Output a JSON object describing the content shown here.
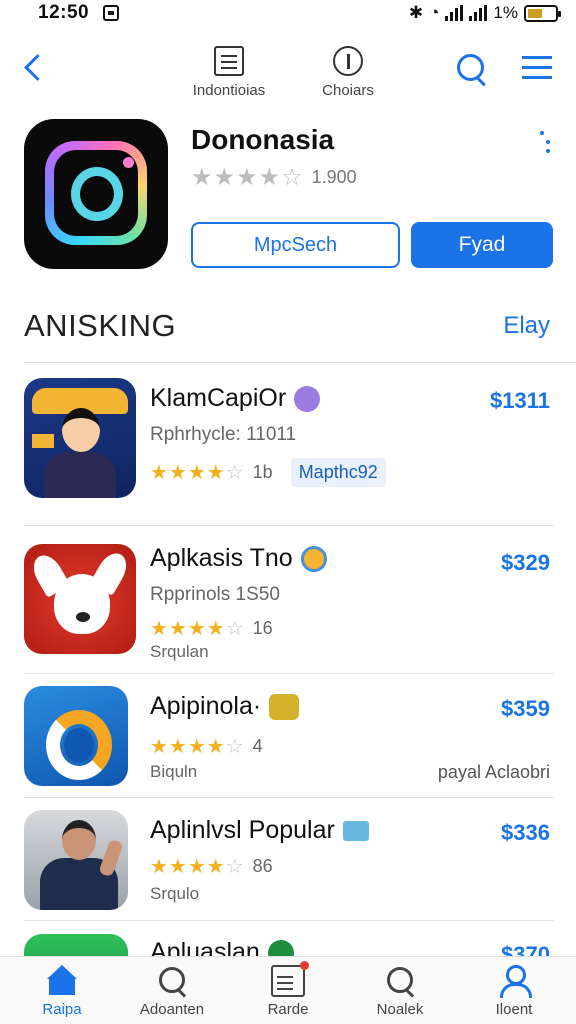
{
  "status_bar": {
    "time": "12:50",
    "battery": "1%"
  },
  "nav": {
    "tab1_label": "Indontioias",
    "tab2_label": "Choiars"
  },
  "app": {
    "title": "Dononasia",
    "rating_count": "1.900",
    "button_secondary": "MpcSech",
    "button_primary": "Fyad"
  },
  "section": {
    "title": "ANISKING",
    "link": "Elay"
  },
  "list": [
    {
      "name": "KlamCapiOr",
      "sub": "Rphrhycle: 11011",
      "rating": "1b",
      "tag": "Mapthc92",
      "price": "$1311"
    },
    {
      "name": "Aplkasis Tno",
      "sub": "Rpprinols 1S50",
      "rating": "16",
      "extra_left": "Srqulan",
      "price": "$329"
    },
    {
      "name": "Apipinola·",
      "rating": "4",
      "extra_left": "Biquln",
      "extra_right": "payal Aclaobri",
      "price": "$359"
    },
    {
      "name": "Aplinlvsl Popular",
      "rating": "86",
      "extra_left": "Srqulo",
      "price": "$336"
    },
    {
      "name": "Apluaslan",
      "price": "$370"
    }
  ],
  "tabbar": {
    "tab1": "Raipa",
    "tab2": "Adoanten",
    "tab3": "Rarde",
    "tab4": "Noalek",
    "tab5": "Iloent"
  },
  "colors": {
    "accent": "#1a73e8",
    "star": "#f2b01e"
  }
}
